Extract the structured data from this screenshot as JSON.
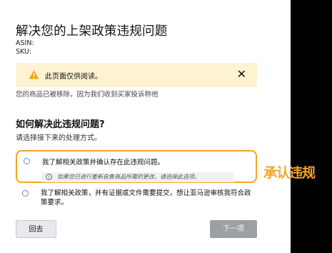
{
  "page": {
    "title": "解决您的上架政策违规问题",
    "asin_label": "ASIN:",
    "sku_label": "SKU:"
  },
  "alert": {
    "text": "此页面仅供阅读。",
    "icon": "warning-icon",
    "close_icon": "close-icon",
    "close_symbol": "✕"
  },
  "removal_notice": "您的商品已被移除，因为我们收到买家投诉称他",
  "resolution": {
    "heading": "如何解决此违规问题?",
    "instruction": "请选择接下来的处理方式。",
    "options": [
      {
        "label": "我了解相关政策并确认存在此违规问题。",
        "hint": "如果您已进行重新启售商品所需的更改，请选择此选项。",
        "selected": false
      },
      {
        "label": "我了解相关政策，并有证据或文件需要提交，想让亚马逊审核我符合政策要求。",
        "selected": false
      }
    ]
  },
  "annotation": {
    "text": "承认违规",
    "color": "#f5a521"
  },
  "buttons": {
    "back": "回去",
    "next": "下一项"
  },
  "colors": {
    "alert_bg": "#fdf3d2",
    "highlight": "#f5a521",
    "disabled_button": "#9aa0a3"
  }
}
